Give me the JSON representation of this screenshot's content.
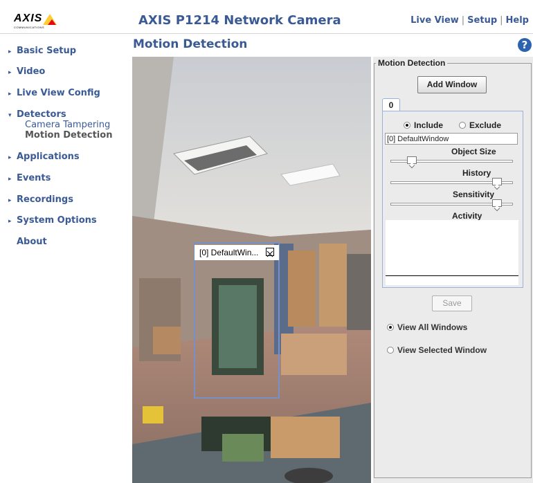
{
  "header": {
    "logo_text": "AXIS",
    "logo_sub": "COMMUNICATIONS",
    "product_title": "AXIS P1214 Network Camera",
    "nav": [
      "Live View",
      "Setup",
      "Help"
    ]
  },
  "sidebar": {
    "items": [
      {
        "label": "Basic Setup"
      },
      {
        "label": "Video"
      },
      {
        "label": "Live View Config"
      },
      {
        "label": "Detectors"
      },
      {
        "label": "Applications"
      },
      {
        "label": "Events"
      },
      {
        "label": "Recordings"
      },
      {
        "label": "System Options"
      },
      {
        "label": "About"
      }
    ],
    "sub_items": [
      "Camera Tampering",
      "Motion Detection"
    ]
  },
  "page": {
    "title": "Motion Detection",
    "help": "?"
  },
  "camera": {
    "window_title": "[0] DefaultWin..."
  },
  "panel": {
    "legend": "Motion Detection",
    "add_window": "Add Window",
    "tab": "0",
    "include": "Include",
    "exclude": "Exclude",
    "window_name": "[0] DefaultWindow",
    "object_size_label": "Object Size",
    "history_label": "History",
    "sensitivity_label": "Sensitivity",
    "activity_label": "Activity",
    "save": "Save",
    "view_all": "View All Windows",
    "view_selected": "View Selected Window",
    "object_size_level": 0.15,
    "history_level": 0.9,
    "sensitivity_level": 0.9
  },
  "colors": {
    "accent": "#3a5a96",
    "help_icon": "#2d62b0",
    "window_border": "#7890c8"
  }
}
